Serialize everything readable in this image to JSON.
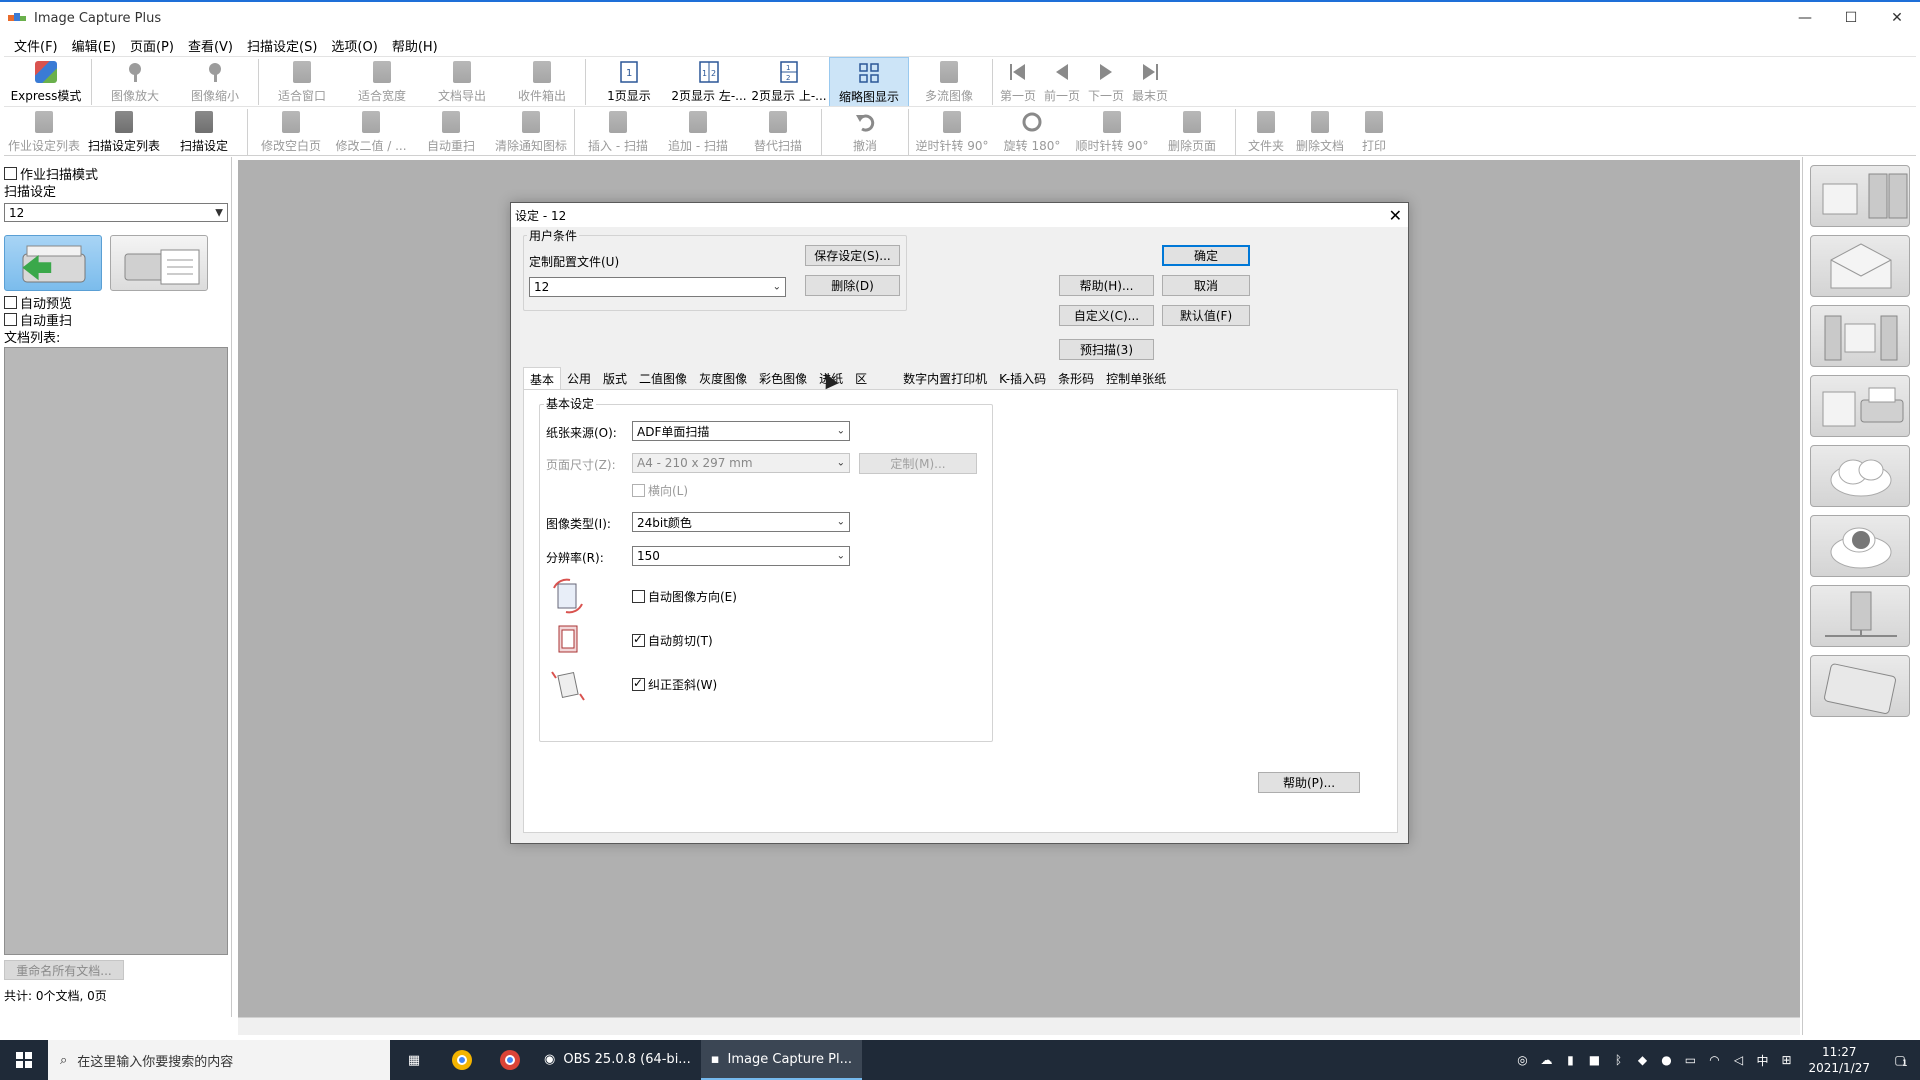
{
  "window": {
    "title": "Image Capture Plus",
    "minimize": "—",
    "maximize": "☐",
    "close": "✕"
  },
  "menu": [
    "文件(F)",
    "编辑(E)",
    "页面(P)",
    "查看(V)",
    "扫描设定(S)",
    "选项(O)",
    "帮助(H)"
  ],
  "toolbar1": [
    {
      "label": "Express模式",
      "enabled": true
    },
    {
      "label": "图像放大",
      "enabled": false
    },
    {
      "label": "图像缩小",
      "enabled": false
    },
    {
      "label": "适合窗口",
      "enabled": false
    },
    {
      "label": "适合宽度",
      "enabled": false
    },
    {
      "label": "文档导出",
      "enabled": false
    },
    {
      "label": "收件箱出",
      "enabled": false
    },
    {
      "label": "1页显示",
      "enabled": true
    },
    {
      "label": "2页显示 左-...",
      "enabled": true
    },
    {
      "label": "2页显示 上-...",
      "enabled": true
    },
    {
      "label": "缩略图显示",
      "enabled": true,
      "active": true
    },
    {
      "label": "多流图像",
      "enabled": false
    },
    {
      "label": "第一页",
      "enabled": false
    },
    {
      "label": "前一页",
      "enabled": false
    },
    {
      "label": "下一页",
      "enabled": false
    },
    {
      "label": "最末页",
      "enabled": false
    }
  ],
  "toolbar2": [
    {
      "label": "作业设定列表",
      "enabled": false
    },
    {
      "label": "扫描设定列表",
      "enabled": true
    },
    {
      "label": "扫描设定",
      "enabled": true
    },
    {
      "label": "修改空白页",
      "enabled": false
    },
    {
      "label": "修改二值 / ...",
      "enabled": false
    },
    {
      "label": "自动重扫",
      "enabled": false
    },
    {
      "label": "清除通知图标",
      "enabled": false
    },
    {
      "label": "插入 - 扫描",
      "enabled": false
    },
    {
      "label": "追加 - 扫描",
      "enabled": false
    },
    {
      "label": "替代扫描",
      "enabled": false
    },
    {
      "label": "撤消",
      "enabled": false
    },
    {
      "label": "逆时针转 90°",
      "enabled": false
    },
    {
      "label": "旋转 180°",
      "enabled": false
    },
    {
      "label": "顺时针转 90°",
      "enabled": false
    },
    {
      "label": "删除页面",
      "enabled": false
    },
    {
      "label": "文件夹",
      "enabled": false
    },
    {
      "label": "删除文档",
      "enabled": false
    },
    {
      "label": "打印",
      "enabled": false
    }
  ],
  "left": {
    "job_scan_mode": "作业扫描模式",
    "scan_settings_label": "扫描设定",
    "scan_settings_value": "12",
    "auto_preview": "自动预览",
    "auto_rescan": "自动重扫",
    "doc_list_label": "文档列表:",
    "rename_all": "重命名所有文档...",
    "total": "共计:   0个文档,    0页"
  },
  "dialog": {
    "title": "设定 - 12",
    "user_conditions": "用户条件",
    "profile_label": "定制配置文件(U)",
    "profile_value": "12",
    "save_settings": "保存设定(S)...",
    "delete": "删除(D)",
    "ok": "确定",
    "help": "帮助(H)...",
    "cancel": "取消",
    "customize": "自定义(C)...",
    "default": "默认值(F)",
    "prescan": "预扫描(3)",
    "tabs": [
      "基本",
      "公用",
      "版式",
      "二值图像",
      "灰度图像",
      "彩色图像",
      "进纸",
      "区",
      "数字内置打印机",
      "K-插入码",
      "条形码",
      "控制单张纸"
    ],
    "active_tab": "基本",
    "basic_group": "基本设定",
    "paper_source_label": "纸张来源(O):",
    "paper_source_value": "ADF单面扫描",
    "page_size_label": "页面尺寸(Z):",
    "page_size_value": "A4 - 210 x 297 mm",
    "custom_btn": "定制(M)...",
    "landscape": "横向(L)",
    "image_type_label": "图像类型(I):",
    "image_type_value": "24bit颜色",
    "resolution_label": "分辨率(R):",
    "resolution_value": "150",
    "auto_orientation": "自动图像方向(E)",
    "auto_orientation_checked": false,
    "auto_crop": "自动剪切(T)",
    "auto_crop_checked": true,
    "deskew": "纠正歪斜(W)",
    "deskew_checked": true,
    "help_p": "帮助(P)..."
  },
  "taskbar": {
    "search_placeholder": "在这里输入你要搜索的内容",
    "apps": [
      {
        "label": "OBS 25.0.8 (64-bi...",
        "active": false
      },
      {
        "label": "Image Capture Pl...",
        "active": true
      }
    ],
    "ime": "中",
    "time": "11:27",
    "date": "2021/1/27",
    "notif_count": "1"
  },
  "colors": {
    "accent": "#0078d7",
    "workspace": "#b0b0b0",
    "taskbar": "#1f2a38",
    "active_tool": "#cce4f7"
  }
}
